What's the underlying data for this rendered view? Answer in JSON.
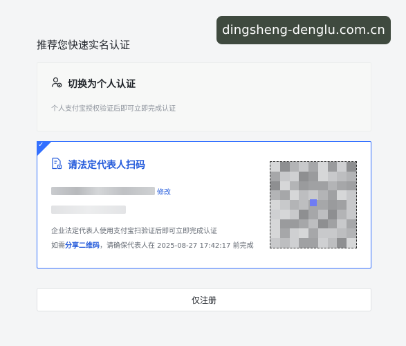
{
  "watermark": {
    "text": "dingsheng-denglu.com.cn"
  },
  "page": {
    "title": "推荐您快速实名认证"
  },
  "personal_option": {
    "icon": "person-verify-icon",
    "label": "切换为个人认证",
    "description": "个人支付宝授权验证后即可立即完成认证"
  },
  "legal_option": {
    "icon": "document-scan-icon",
    "label": "请法定代表人扫码",
    "edit_label": "修改",
    "description": "企业法定代表人使用支付宝扫验证后即可立即完成认证",
    "share_prefix": "如需",
    "share_link": "分享二维码",
    "share_suffix": "，请确保代表人在 2025-08-27 17:42:17 前完成",
    "selected": true
  },
  "footer": {
    "register_label": "仅注册"
  },
  "colors": {
    "accent": "#3370ff",
    "link": "#245bdb"
  }
}
